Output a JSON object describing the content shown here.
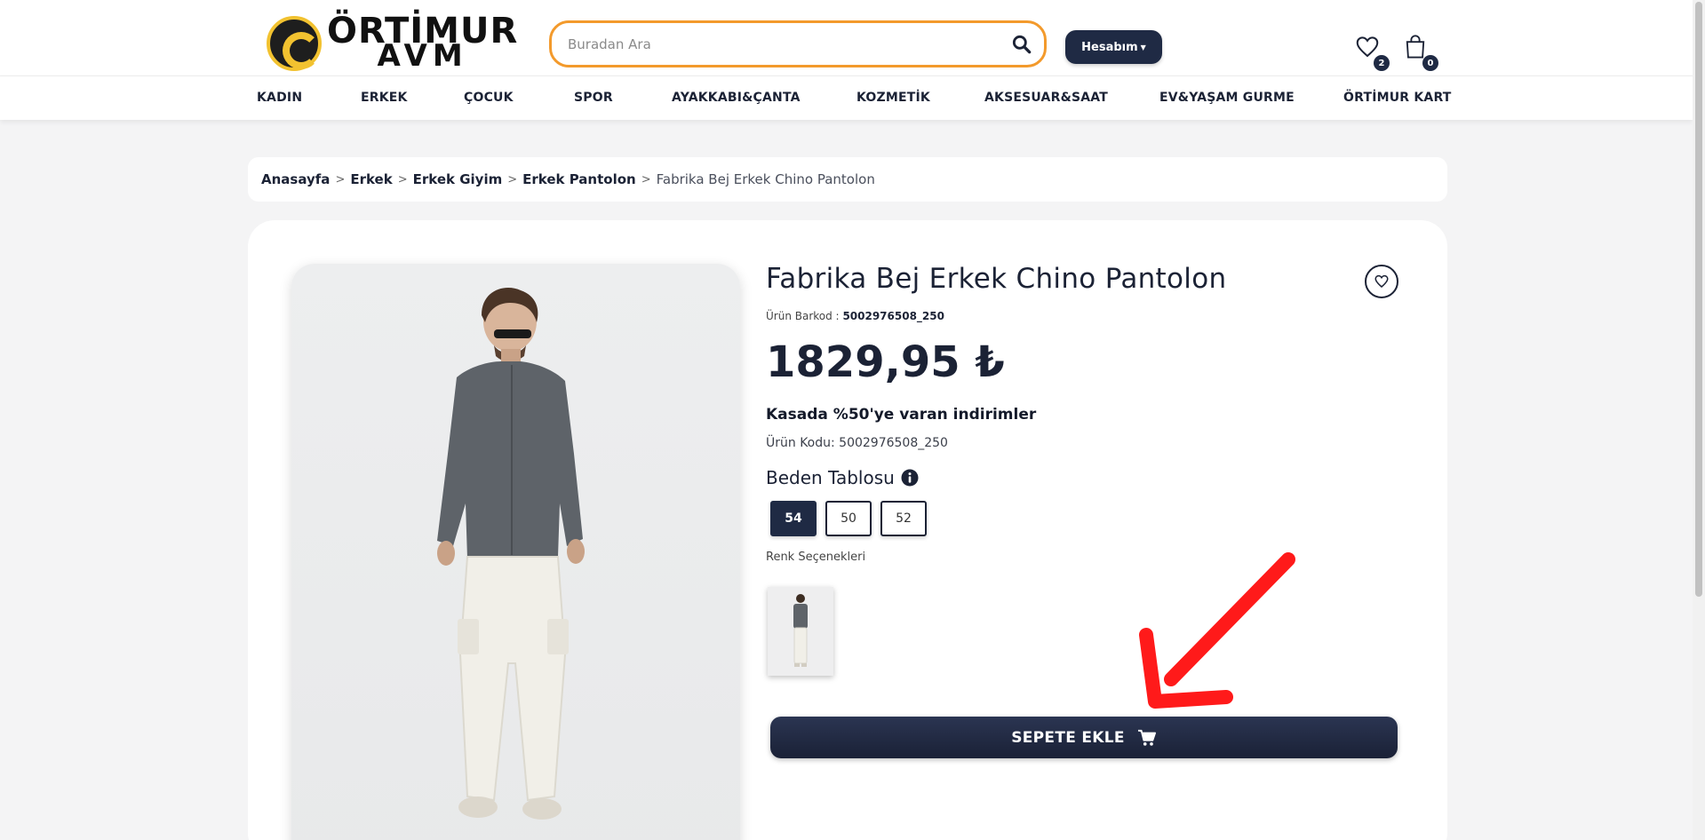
{
  "brand": {
    "line1": "ÖRTİMUR",
    "line2": "AVM",
    "badge_text": "ÖRTİMUR"
  },
  "search": {
    "placeholder": "Buradan Ara",
    "icon": "search-icon"
  },
  "account": {
    "label": "Hesabım"
  },
  "wishlist": {
    "count": "2",
    "icon": "heart-icon"
  },
  "cart": {
    "count": "0",
    "icon": "shopping-bag-icon"
  },
  "nav": {
    "items": [
      {
        "label": "KADIN"
      },
      {
        "label": "ERKEK"
      },
      {
        "label": "ÇOCUK"
      },
      {
        "label": "SPOR"
      },
      {
        "label": "AYAKKABI&ÇANTA"
      },
      {
        "label": "KOZMETİK"
      },
      {
        "label": "AKSESUAR&SAAT"
      },
      {
        "label": "EV&YAŞAM GURME"
      },
      {
        "label": "ÖRTİMUR KART"
      }
    ]
  },
  "breadcrumb": {
    "items": [
      {
        "label": "Anasayfa"
      },
      {
        "label": "Erkek"
      },
      {
        "label": "Erkek Giyim"
      },
      {
        "label": "Erkek Pantolon"
      }
    ],
    "separator": ">",
    "current": "Fabrika Bej Erkek Chino Pantolon"
  },
  "product": {
    "title": "Fabrika Bej Erkek Chino Pantolon",
    "barcode_label": "Ürün Barkod :",
    "barcode_value": "5002976508_250",
    "price": "1829,95 ₺",
    "promo": "Kasada %50'ye varan indirimler",
    "code": "Ürün Kodu: 5002976508_250",
    "size_table_label": "Beden Tablosu",
    "sizes": [
      {
        "label": "54",
        "selected": true
      },
      {
        "label": "50",
        "selected": false
      },
      {
        "label": "52",
        "selected": false
      }
    ],
    "color_options_label": "Renk Seçenekleri",
    "add_to_cart_label": "SEPETE EKLE"
  },
  "colors": {
    "primary": "#1f2a44",
    "search_border": "#f39a2c",
    "logo_yellow": "#f2c230",
    "arrow": "#ff1a1a"
  }
}
